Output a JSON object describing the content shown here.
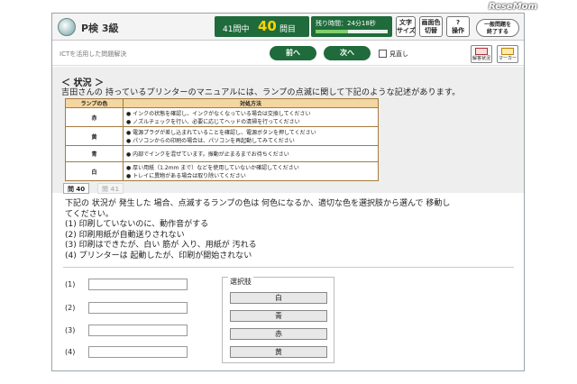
{
  "watermark": "ReseMom",
  "header": {
    "brand": "P検 3級",
    "progress_total": "41問中",
    "progress_current": "40",
    "progress_unit": "問目",
    "timer_label": "残り時間：24分18秒",
    "timer_fraction": 0.45,
    "text_size_btn": "文字\nサイズ",
    "screen_switch_btn": "画面色\n切替",
    "help_btn": "?\n操作",
    "end_btn": "一般問題を\n終了する"
  },
  "subbar": {
    "breadcrumb": "ICTを活用した問題解決",
    "prev": "前へ",
    "next": "次へ",
    "review": "見直し",
    "answer_status": "解答状況",
    "marker": "マーカー"
  },
  "status": {
    "title": "＜ 状況 ＞",
    "description": "吉田さんの 持っているプリンターのマニュアルには、ランプの点滅に関して下記のような記述があります。",
    "table": {
      "headers": [
        "ランプの色",
        "対処方法"
      ],
      "rows": [
        {
          "color": "赤",
          "actions": [
            "インクの状態を確認し、インクがなくなっている場合は交換してください",
            "ノズルチェックを行い、必要に応じてヘッドの清掃を行ってください"
          ]
        },
        {
          "color": "黄",
          "actions": [
            "電源プラグが差し込まれていることを確認し、電源ボタンを押してください",
            "パソコンからの印刷の場合は、パソコンを再起動してみてください"
          ]
        },
        {
          "color": "青",
          "actions": [
            "内部でインクを混ぜています。振動が止まるまでお待ちください"
          ]
        },
        {
          "color": "白",
          "actions": [
            "厚い用紙（1.2mm まで）などを使用していないか確認してください",
            "トレイに異物がある場合は取り除いてください"
          ]
        }
      ]
    }
  },
  "tabs": [
    "問 40",
    "問 41"
  ],
  "question": {
    "text_1": "下記の 状況が 発生した 場合、点滅するランプの色は 何色になるか、適切な色を選択肢から選んで 移動し",
    "text_2": "てください。",
    "items": [
      "(1) 印刷していないのに、動作音がする",
      "(2) 印刷用紙が自動送りされない",
      "(3) 印刷はできたが、白い 筋が 入り、用紙が 汚れる",
      "(4) プリンターは 起動したが、印刷が開始されない"
    ]
  },
  "answers": [
    "(1)",
    "(2)",
    "(3)",
    "(4)"
  ],
  "choices": {
    "title": "選択肢",
    "options": [
      "白",
      "青",
      "赤",
      "黄"
    ]
  }
}
